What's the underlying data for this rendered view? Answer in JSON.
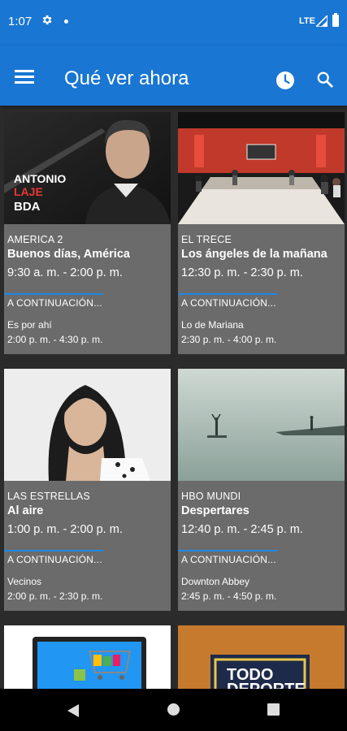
{
  "status_bar": {
    "time": "1:07",
    "network": "LTE"
  },
  "app_bar": {
    "title": "Qué ver ahora"
  },
  "next_label": "A CONTINUACIÓN...",
  "cards": [
    {
      "channel": "AMERICA 2",
      "show": "Buenos días, América",
      "time": "9:30 a. m. - 2:00 p. m.",
      "next_show": "Es por ahí",
      "next_time": "2:00 p. m. - 4:30 p. m.",
      "image_text": [
        "ANTONIO",
        "LAJE",
        "BDA"
      ]
    },
    {
      "channel": "EL TRECE",
      "show": "Los ángeles de la mañana",
      "time": "12:30 p. m. - 2:30 p. m.",
      "next_show": "Lo de Mariana",
      "next_time": "2:30 p. m. - 4:00 p. m."
    },
    {
      "channel": "LAS ESTRELLAS",
      "show": "Al aire",
      "time": "1:00 p. m. - 2:00 p. m.",
      "next_show": "Vecinos",
      "next_time": "2:00 p. m. - 2:30 p. m."
    },
    {
      "channel": "HBO MUNDI",
      "show": "Despertares",
      "time": "12:40 p. m. - 2:45 p. m.",
      "next_show": "Downton Abbey",
      "next_time": "2:45 p. m. - 4:50 p. m."
    },
    {
      "image_text": [
        "TODO",
        "DEPORTE"
      ]
    }
  ],
  "colors": {
    "primary": "#1976d2",
    "card": "#6b6b6b",
    "background": "#2b2b2b",
    "accent_line": "#1e88e5"
  }
}
